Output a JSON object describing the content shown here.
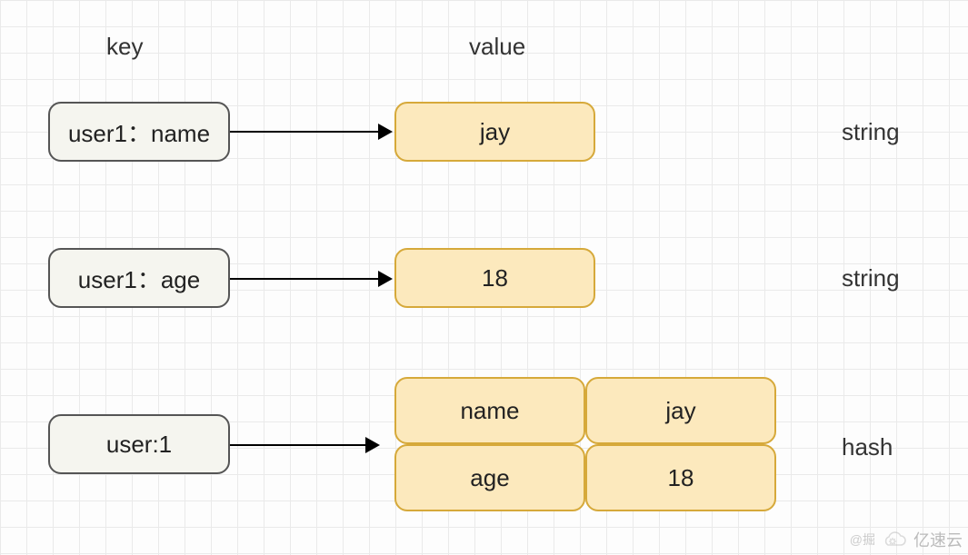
{
  "headers": {
    "key": "key",
    "value": "value"
  },
  "rows": [
    {
      "key": "user1：name",
      "value": "jay",
      "type": "string"
    },
    {
      "key": "user1：age",
      "value": "18",
      "type": "string"
    }
  ],
  "hash_row": {
    "key": "user:1",
    "type": "hash",
    "cells": [
      {
        "field": "name",
        "val": "jay"
      },
      {
        "field": "age",
        "val": "18"
      }
    ]
  },
  "watermark": {
    "small": "@掘",
    "brand": "亿速云"
  }
}
